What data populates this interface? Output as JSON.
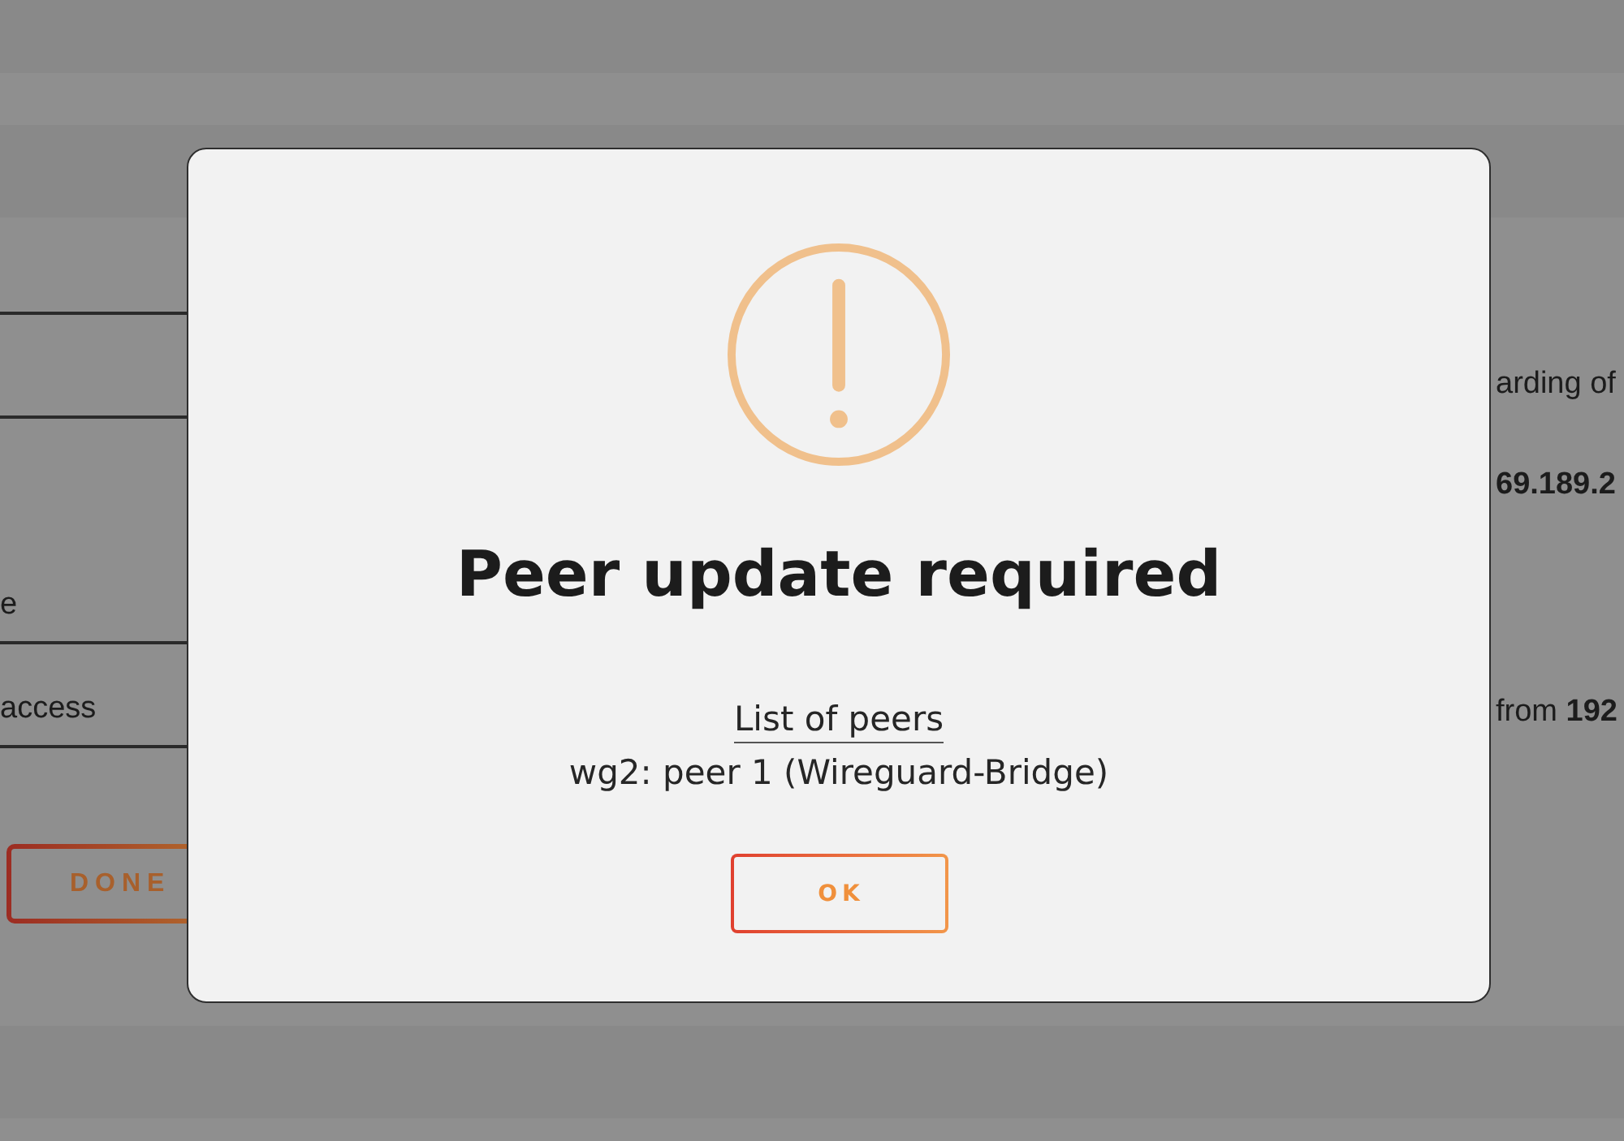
{
  "page": {
    "notes": [
      "arding of"
    ],
    "value": "69.189.2",
    "row_labels": [
      "e",
      "access"
    ],
    "row_note": "from **192**",
    "done_button": "DONE"
  },
  "dialog": {
    "title": "Peer update required",
    "link": "List of peers",
    "items": [
      "wg2: peer 1 (Wireguard-Bridge)"
    ],
    "buttons": [
      "OK"
    ]
  }
}
